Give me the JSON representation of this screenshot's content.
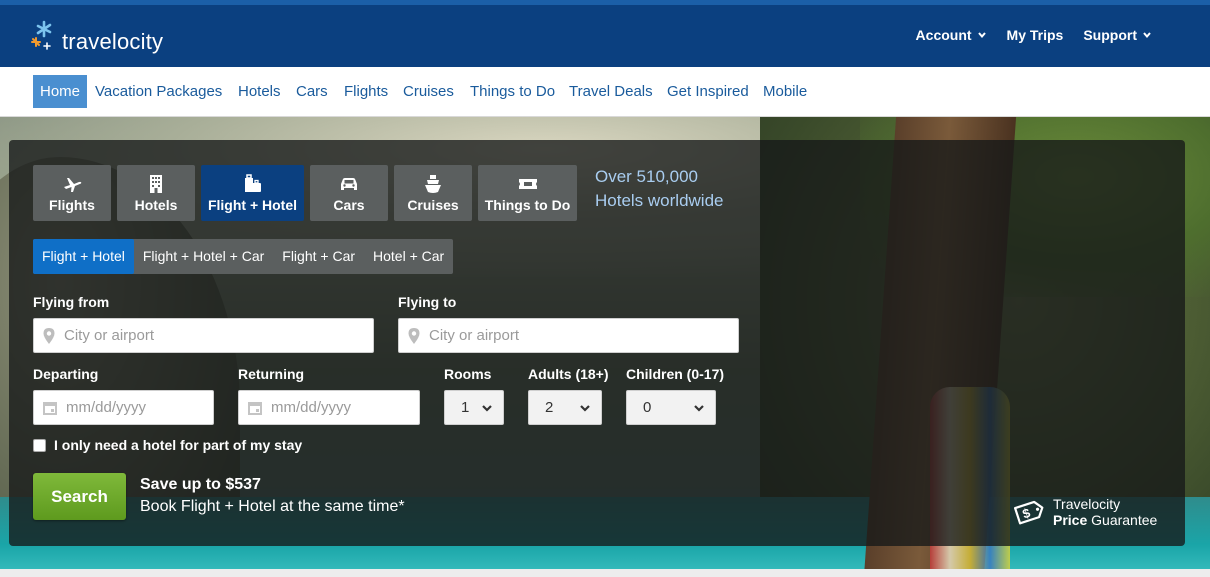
{
  "header": {
    "logo_text": "travelocity",
    "nav": [
      {
        "label": "Account",
        "has_dropdown": true
      },
      {
        "label": "My Trips",
        "has_dropdown": false
      },
      {
        "label": "Support",
        "has_dropdown": true
      }
    ]
  },
  "subnav": {
    "items": [
      {
        "label": "Home",
        "active": true
      },
      {
        "label": "Vacation Packages"
      },
      {
        "label": "Hotels"
      },
      {
        "label": "Cars"
      },
      {
        "label": "Flights"
      },
      {
        "label": "Cruises"
      },
      {
        "label": "Things to Do"
      },
      {
        "label": "Travel Deals"
      },
      {
        "label": "Get Inspired"
      },
      {
        "label": "Mobile"
      }
    ]
  },
  "search": {
    "product_tabs": [
      {
        "label": "Flights",
        "icon": "airplane-icon"
      },
      {
        "label": "Hotels",
        "icon": "building-icon"
      },
      {
        "label": "Flight + Hotel",
        "icon": "luggage-icon",
        "active": true
      },
      {
        "label": "Cars",
        "icon": "car-icon"
      },
      {
        "label": "Cruises",
        "icon": "ship-icon"
      },
      {
        "label": "Things to Do",
        "icon": "ticket-icon"
      }
    ],
    "promo_line1": "Over 510,000",
    "promo_line2": "Hotels worldwide",
    "package_tabs": [
      {
        "label": "Flight + Hotel",
        "active": true
      },
      {
        "label": "Flight + Hotel + Car"
      },
      {
        "label": "Flight + Car"
      },
      {
        "label": "Hotel + Car"
      }
    ],
    "flying_from": {
      "label": "Flying from",
      "placeholder": "City or airport"
    },
    "flying_to": {
      "label": "Flying to",
      "placeholder": "City or airport"
    },
    "departing": {
      "label": "Departing",
      "placeholder": "mm/dd/yyyy"
    },
    "returning": {
      "label": "Returning",
      "placeholder": "mm/dd/yyyy"
    },
    "rooms": {
      "label": "Rooms",
      "value": "1"
    },
    "adults": {
      "label": "Adults (18+)",
      "value": "2"
    },
    "children": {
      "label": "Children (0-17)",
      "value": "0"
    },
    "partial_stay_label": "I only need a hotel for part of my stay",
    "search_button": "Search",
    "save_title": "Save up to $537",
    "save_subtitle": "Book Flight + Hotel at the same time*",
    "guarantee_line1": "Travelocity",
    "guarantee_line2_bold": "Price",
    "guarantee_line2_rest": " Guarantee"
  },
  "colors": {
    "header_bg": "#0b4080",
    "active_tab": "#0b4080",
    "active_subtab": "#0f6fc7",
    "search_green": "#6aa82a",
    "link_blue": "#1a5b9c"
  }
}
